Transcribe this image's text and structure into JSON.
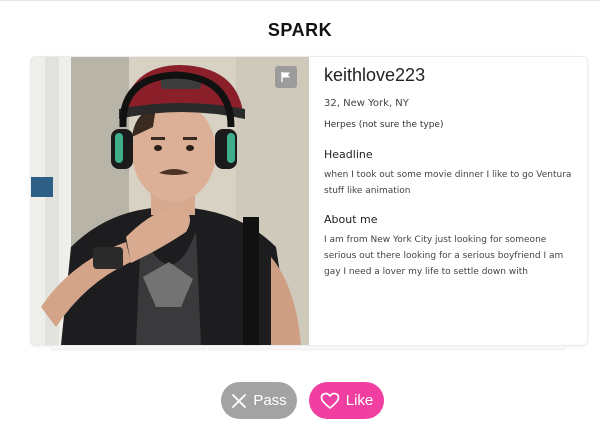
{
  "app": {
    "brand": "SPARK"
  },
  "profile": {
    "username": "keithlove223",
    "location": "32, New York, NY",
    "condition": "Herpes (not sure the type)",
    "headline_title": "Headline",
    "headline_text": "when I took out some movie dinner I like to go Ventura stuff like animation",
    "about_title": "About me",
    "about_text": "I am from New York City just looking for someone serious out there looking for a serious boyfriend I am gay I need a lover my life to settle down with"
  },
  "actions": {
    "pass_label": "Pass",
    "like_label": "Like"
  },
  "icons": {
    "flag": "flag-icon",
    "pass": "x-icon",
    "like": "heart-outline-icon"
  },
  "colors": {
    "like": "#f03fa0",
    "pass": "#a3a3a3",
    "flag_bg": "#9b9b9b"
  }
}
